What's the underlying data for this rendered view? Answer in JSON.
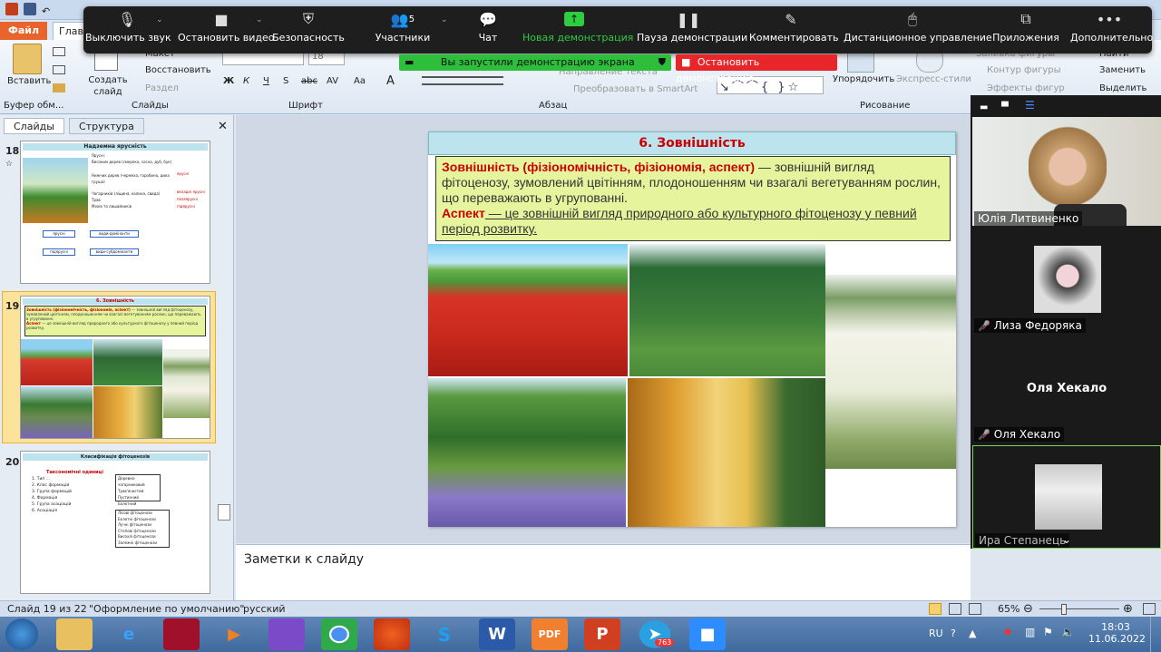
{
  "ppt": {
    "file_tab": "Файл",
    "home_tab": "Глав",
    "clipboard": {
      "paste": "Вставить",
      "group": "Буфер обм..."
    },
    "slides": {
      "create": "Создать слайд",
      "layout": "Макет",
      "restore": "Восстановить",
      "section": "Раздел",
      "group": "Слайды"
    },
    "font": {
      "group": "Шрифт",
      "size": "18",
      "bold": "Ж",
      "italic": "К",
      "underline": "Ч",
      "strike": "S",
      "spacing": "abc",
      "shadow": "AV",
      "case": "Aa",
      "color": "A"
    },
    "paragraph": {
      "group": "Абзац",
      "text_dir": "Направление текста",
      "smartart": "Преобразовать в SmartArt"
    },
    "drawing": {
      "group": "Рисование",
      "arrange": "Упорядочить",
      "styles": "Экспресс-стили",
      "fill": "Заливка фигуры",
      "outline": "Контур фигуры",
      "effects": "Эффекты фигур"
    },
    "editing": {
      "find": "Найти",
      "replace": "Заменить",
      "select": "Выделить"
    }
  },
  "zoom": {
    "items": [
      {
        "label": "Выключить звук",
        "icon": "microphone-icon"
      },
      {
        "label": "Остановить видео",
        "icon": "video-camera-icon"
      },
      {
        "label": "Безопасность",
        "icon": "shield-icon"
      },
      {
        "label": "Участники",
        "count": "5",
        "icon": "participants-icon"
      },
      {
        "label": "Чат",
        "icon": "chat-icon"
      },
      {
        "label": "Новая демонстрация",
        "icon": "share-screen-icon"
      },
      {
        "label": "Пауза демонстрации",
        "icon": "pause-icon"
      },
      {
        "label": "Комментировать",
        "icon": "pen-icon"
      },
      {
        "label": "Дистанционное управление",
        "icon": "mouse-icon"
      },
      {
        "label": "Приложения",
        "icon": "apps-icon"
      },
      {
        "label": "Дополнительно",
        "icon": "more-icon"
      }
    ],
    "share_status": "Вы запустили демонстрацию экрана",
    "stop_share": "Остановить демонстрацию",
    "accent_green": "#2dbe3c",
    "accent_red": "#e8262a"
  },
  "panes": {
    "tab_slides": "Слайды",
    "tab_outline": "Структура"
  },
  "thumbs": [
    {
      "num": "18",
      "title": "Надземна ярусність",
      "rows": [
        "Ярусні:",
        "Високим дерев (смерека, сосна, дуб, бук)",
        "Нижчих дерев (черемха, горобина, дика груша)",
        "Чагарників (ліщина, калина, свида)",
        "Трав",
        "Мохів та лишайників"
      ],
      "labels": [
        "ярусні",
        "вкладні ярусні",
        "позаярусні",
        "підярусні"
      ],
      "boxes": [
        "ярусні",
        "види-домінанти",
        "підярусні",
        "види-субдомінанти"
      ]
    },
    {
      "num": "19",
      "title": "6. Зовнішність"
    },
    {
      "num": "20",
      "title": "Класифікація фітоценозів",
      "subtitle": "Таксономічні одиниці",
      "list": [
        "1. Тип ...",
        "2. Клас формацій",
        "3. Група формацій",
        "4. Формація",
        "5. Група асоціацій",
        "6. Асоціація"
      ],
      "box1": [
        "Деревно-чагарниковий",
        "Трав'янистий",
        "Пустинний",
        "Болотний"
      ],
      "box2": [
        "Лісові фітоценози",
        "Болотні фітоценози",
        "Лучні фітоценози",
        "Степові фітоценози",
        "Висохлі фітоценози",
        "Залежні фітоценози"
      ]
    }
  ],
  "slide": {
    "title": "6. Зовнішність",
    "term1": "Зовнішність (фізіономічність, фізіономія, аспект)",
    "def1": " — зовнішній вигляд фітоценозу, зумовлений цвітінням, плодоношенням  чи взагалі вегетуванням рослин,  що переважають в угрупованні.",
    "term2": "Аспект",
    "def2": " — це зовнішній вигляд природного або культурного фітоценозу у певний період розвитку."
  },
  "notes_placeholder": "Заметки к слайду",
  "status": {
    "slide": "Слайд 19 из 22",
    "theme": "\"Оформление по умолчанию\"",
    "lang": "русский",
    "zoom": "65%"
  },
  "participants": [
    {
      "name": "Юлія Литвиненко",
      "muted": false
    },
    {
      "name": "Лиза Федоряка",
      "muted": true
    },
    {
      "name": "Оля Хекало",
      "muted": true,
      "center": "Оля Хекало"
    },
    {
      "name": "Ира Степанець",
      "muted": false
    }
  ],
  "taskbar": {
    "lang": "RU",
    "time": "18:03",
    "date": "11.06.2022",
    "badge": "763"
  }
}
